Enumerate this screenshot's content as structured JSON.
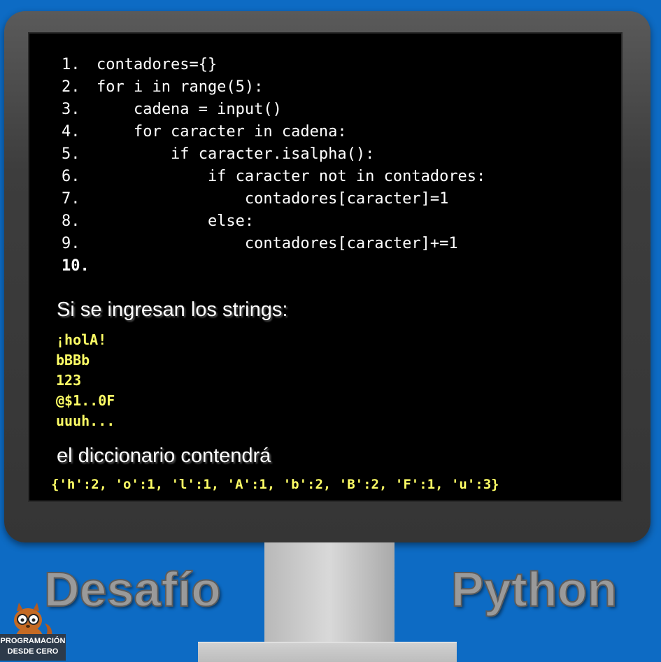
{
  "code": {
    "lines": [
      {
        "num": "1.",
        "text": "contadores={}"
      },
      {
        "num": "2.",
        "text": "for i in range(5):"
      },
      {
        "num": "3.",
        "text": "    cadena = input()"
      },
      {
        "num": "4.",
        "text": "    for caracter in cadena:"
      },
      {
        "num": "5.",
        "text": "        if caracter.isalpha():"
      },
      {
        "num": "6.",
        "text": "            if caracter not in contadores:"
      },
      {
        "num": "7.",
        "text": "                contadores[caracter]=1"
      },
      {
        "num": "8.",
        "text": "            else:"
      },
      {
        "num": "9.",
        "text": "                contadores[caracter]+=1"
      },
      {
        "num": "10.",
        "text": ""
      }
    ]
  },
  "inputs_heading": "Si se ingresan los strings:",
  "input_strings": [
    "¡holA!",
    "bBBb",
    "123",
    "@$1..0F",
    "uuuh..."
  ],
  "result_heading": "el diccionario contendrá",
  "result": "{'h':2, 'o':1, 'l':1, 'A':1, 'b':2, 'B':2, 'F':1, 'u':3}",
  "title_left": "Desafío",
  "title_right": "Python",
  "logo": {
    "line1": "PROGRAMACIÓN",
    "line2": "DESDE CERO",
    "icon": "squirrel-mascot-icon"
  },
  "colors": {
    "background": "#0d6bc4",
    "code_text": "#ffffff",
    "highlight_text": "#ffff66",
    "title_text": "#9a9a9a"
  }
}
